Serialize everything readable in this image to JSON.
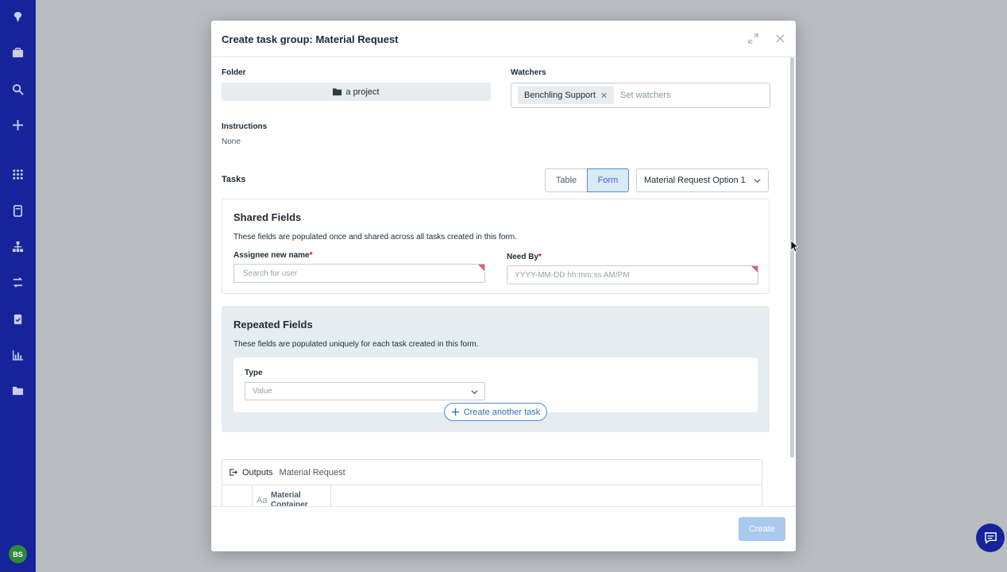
{
  "sidebar": {
    "icons": [
      "benchling-logo-icon",
      "briefcase-icon",
      "search-icon",
      "plus-icon",
      "apps-grid-icon",
      "notebook-icon",
      "hierarchy-icon",
      "workflow-icon",
      "clipboard-check-icon",
      "bar-chart-icon",
      "folder-icon"
    ],
    "avatar_initials": "BS"
  },
  "modal": {
    "title": "Create task group: Material Request",
    "folder": {
      "label": "Folder",
      "value": "a project"
    },
    "watchers": {
      "label": "Watchers",
      "chip": "Benchling Support",
      "placeholder": "Set watchers"
    },
    "instructions": {
      "label": "Instructions",
      "value": "None"
    },
    "tasks": {
      "label": "Tasks",
      "view_table": "Table",
      "view_form": "Form",
      "selected_option": "Material Request Option 1"
    },
    "shared_fields": {
      "title": "Shared Fields",
      "description": "These fields are populated once and shared across all tasks created in this form.",
      "assignee_label": "Assignee new name",
      "assignee_placeholder": "Search for user",
      "need_by_label": "Need By",
      "need_by_placeholder": "YYYY-MM-DD hh:mm:ss AM/PM",
      "required_mark": "*"
    },
    "repeated_fields": {
      "title": "Repeated Fields",
      "description": "These fields are populated uniquely for each task created in this form.",
      "type_label": "Type",
      "type_placeholder": "Value",
      "add_task_label": "Create another task"
    },
    "outputs": {
      "label": "Outputs",
      "schema": "Material Request",
      "column_type": "Aa",
      "column_name": "Material Container"
    },
    "footer": {
      "create_label": "Create"
    }
  },
  "colors": {
    "sidebar": "#17239a",
    "accent": "#4a90d6",
    "create_disabled": "#a9c9ee"
  }
}
